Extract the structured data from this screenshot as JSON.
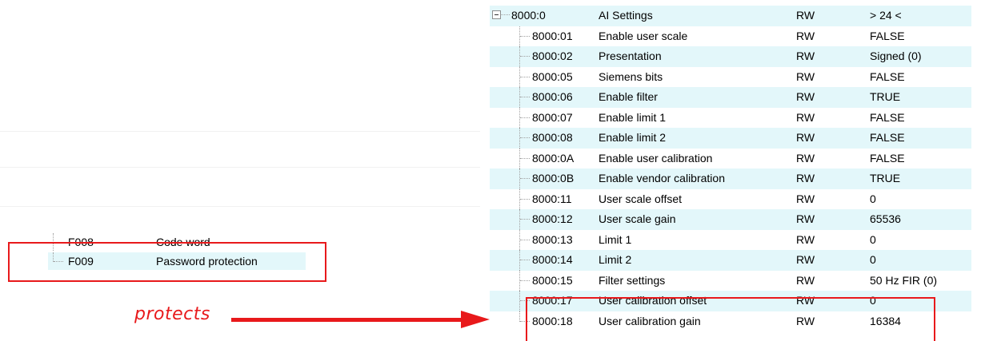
{
  "left_tree": {
    "rows": [
      {
        "index": "F008",
        "name": "Code word"
      },
      {
        "index": "F009",
        "name": "Password protection"
      }
    ]
  },
  "annotation": {
    "label": "protects",
    "color": "#e8191b"
  },
  "settings_tree": {
    "root": {
      "index": "8000:0",
      "name": "AI Settings",
      "flags": "RW",
      "value": "> 24 <"
    },
    "rows": [
      {
        "index": "8000:01",
        "name": "Enable user scale",
        "flags": "RW",
        "value": "FALSE"
      },
      {
        "index": "8000:02",
        "name": "Presentation",
        "flags": "RW",
        "value": "Signed (0)"
      },
      {
        "index": "8000:05",
        "name": "Siemens bits",
        "flags": "RW",
        "value": "FALSE"
      },
      {
        "index": "8000:06",
        "name": "Enable filter",
        "flags": "RW",
        "value": "TRUE"
      },
      {
        "index": "8000:07",
        "name": "Enable limit 1",
        "flags": "RW",
        "value": "FALSE"
      },
      {
        "index": "8000:08",
        "name": "Enable limit 2",
        "flags": "RW",
        "value": "FALSE"
      },
      {
        "index": "8000:0A",
        "name": "Enable user calibration",
        "flags": "RW",
        "value": "FALSE"
      },
      {
        "index": "8000:0B",
        "name": "Enable vendor calibration",
        "flags": "RW",
        "value": "TRUE"
      },
      {
        "index": "8000:11",
        "name": "User scale offset",
        "flags": "RW",
        "value": "0"
      },
      {
        "index": "8000:12",
        "name": "User scale gain",
        "flags": "RW",
        "value": "65536"
      },
      {
        "index": "8000:13",
        "name": "Limit 1",
        "flags": "RW",
        "value": "0"
      },
      {
        "index": "8000:14",
        "name": "Limit 2",
        "flags": "RW",
        "value": "0"
      },
      {
        "index": "8000:15",
        "name": "Filter settings",
        "flags": "RW",
        "value": "50 Hz FIR (0)"
      },
      {
        "index": "8000:17",
        "name": "User calibration offset",
        "flags": "RW",
        "value": "0"
      },
      {
        "index": "8000:18",
        "name": "User calibration gain",
        "flags": "RW",
        "value": "16384"
      }
    ]
  },
  "colors": {
    "row_highlight": "#e3f7fa",
    "highlight_box": "#e8191b"
  }
}
